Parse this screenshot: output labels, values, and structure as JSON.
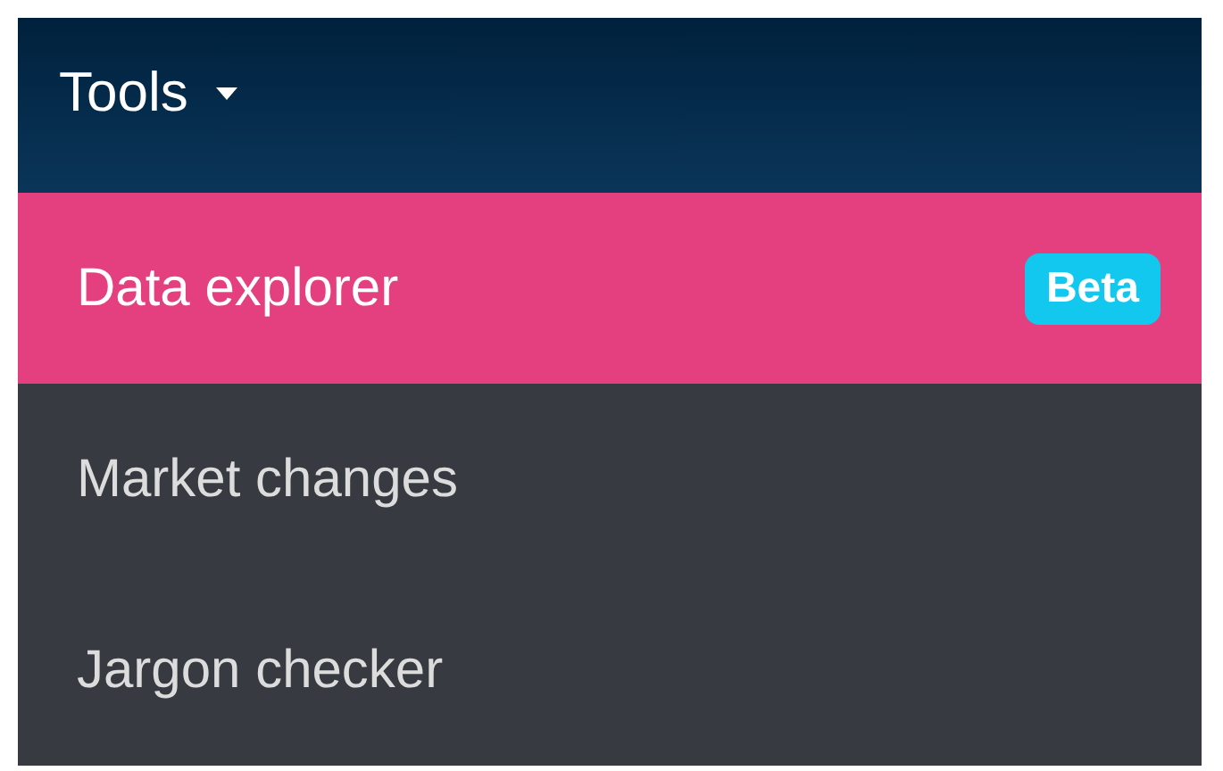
{
  "menu": {
    "title": "Tools",
    "expanded": true,
    "items": [
      {
        "label": "Data explorer",
        "selected": true,
        "badge": "Beta"
      },
      {
        "label": "Market changes",
        "selected": false
      },
      {
        "label": "Jargon checker",
        "selected": false
      }
    ]
  }
}
